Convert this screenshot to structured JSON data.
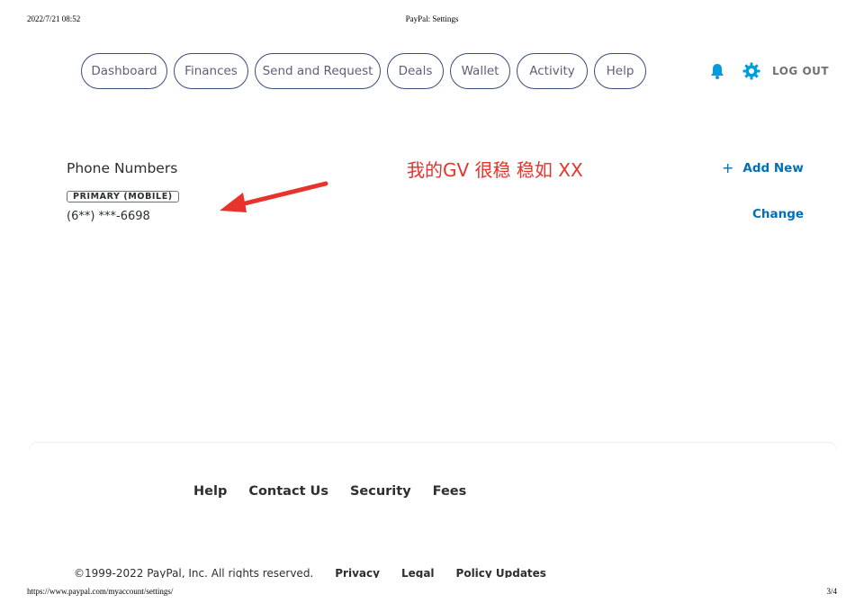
{
  "print": {
    "datetime": "2022/7/21 08:52",
    "page_title": "PayPal: Settings",
    "url": "https://www.paypal.com/myaccount/settings/",
    "page_indicator": "3/4"
  },
  "nav": {
    "items": [
      {
        "label": "Dashboard"
      },
      {
        "label": "Finances"
      },
      {
        "label": "Send and Request"
      },
      {
        "label": "Deals"
      },
      {
        "label": "Wallet"
      },
      {
        "label": "Activity"
      },
      {
        "label": "Help"
      }
    ],
    "notifications_icon": "bell-icon",
    "settings_icon": "gear-icon",
    "logout_label": "LOG OUT"
  },
  "phone": {
    "section_title": "Phone Numbers",
    "badge": "PRIMARY (MOBILE)",
    "number": "(6**) ***-6698",
    "add_new_label": "Add New",
    "add_icon": "plus-icon",
    "change_label": "Change"
  },
  "annotation": {
    "text": "我的GV 很稳 稳如 XX",
    "color": "#e8322c"
  },
  "footer": {
    "links": [
      "Help",
      "Contact Us",
      "Security",
      "Fees"
    ],
    "copyright": "©1999-2022 PayPal, Inc. All rights reserved.",
    "legal_links": [
      "Privacy",
      "Legal",
      "Policy Updates"
    ]
  },
  "colors": {
    "link_blue": "#0070ba",
    "nav_border": "#3a4a7a",
    "icon_blue": "#009cde"
  }
}
